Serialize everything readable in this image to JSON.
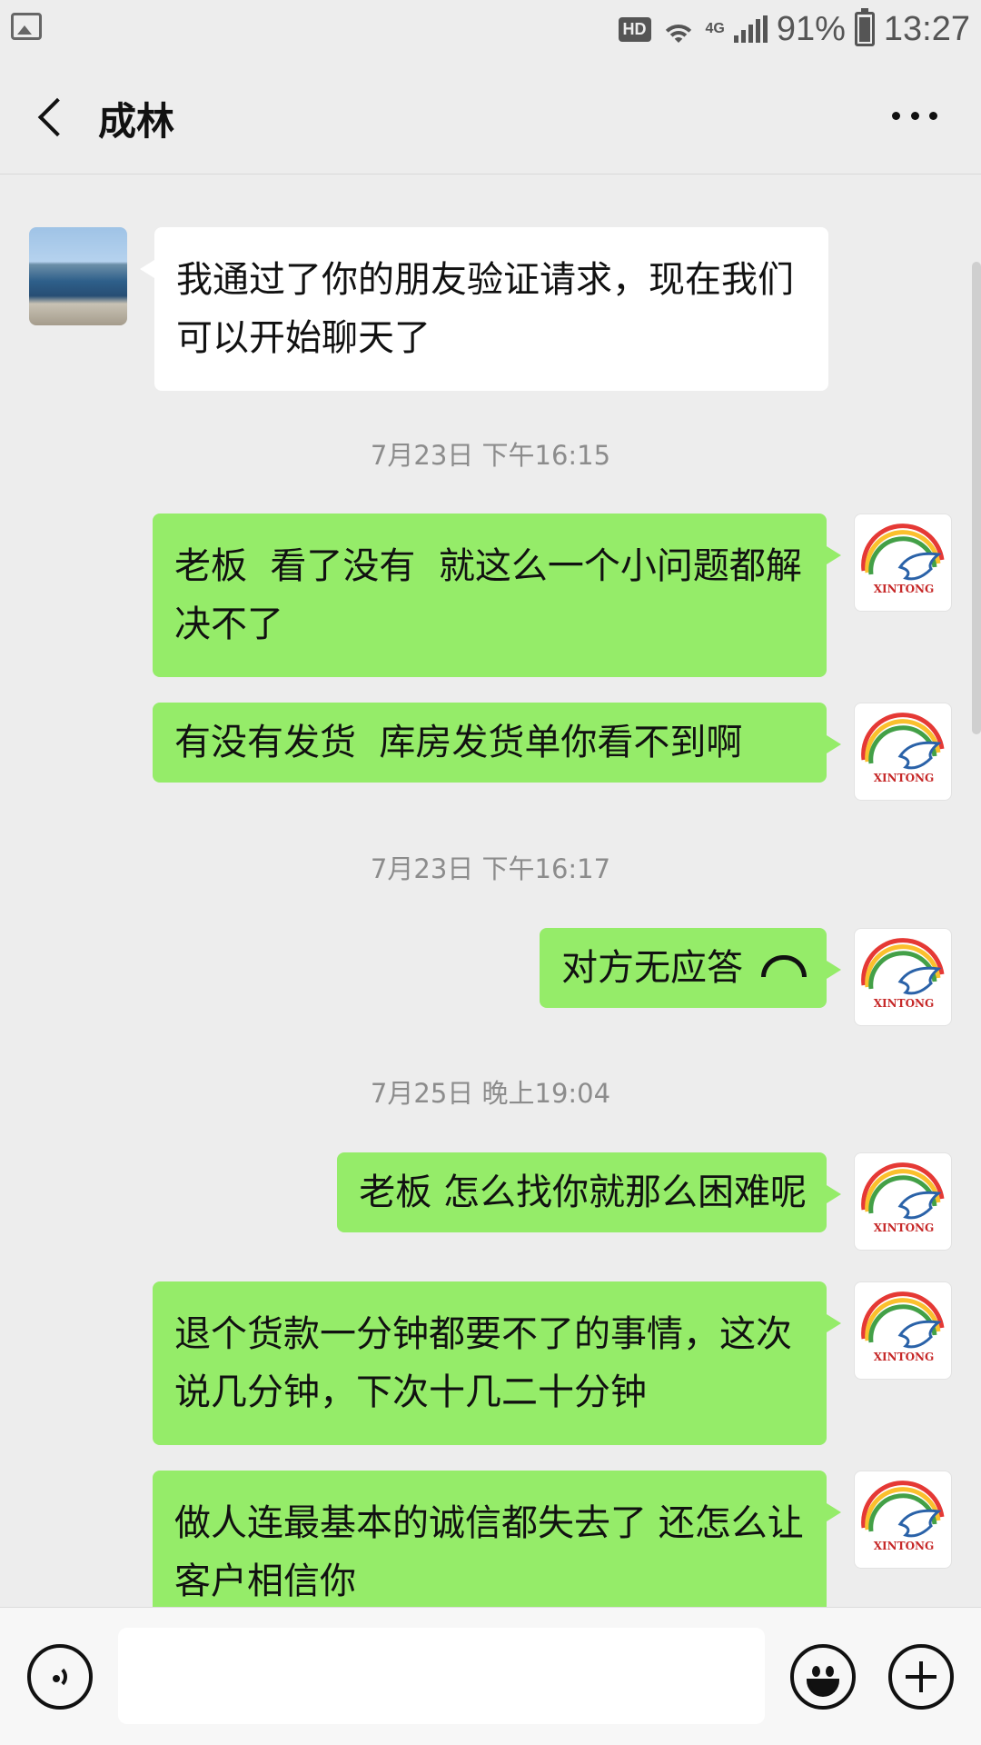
{
  "status_bar": {
    "hd_badge": "HD",
    "network_type": "4G",
    "battery_percent": "91%",
    "time": "13:27"
  },
  "header": {
    "title": "成林",
    "back_icon": "chevron-left-icon",
    "more_icon": "more-dots-icon"
  },
  "chat": {
    "messages": [
      {
        "side": "left",
        "avatar": "lake-photo",
        "text": "我通过了你的朋友验证请求，现在我们可以开始聊天了"
      },
      {
        "timestamp": "7月23日 下午16:15"
      },
      {
        "side": "right",
        "avatar": "xintong-logo",
        "text": "老板  看了没有  就这么一个小问题都解决不了"
      },
      {
        "side": "right",
        "avatar": "xintong-logo",
        "text": "有没有发货  库房发货单你看不到啊"
      },
      {
        "timestamp": "7月23日 下午16:17"
      },
      {
        "side": "right",
        "avatar": "xintong-logo",
        "text": "对方无应答",
        "icon": "hangup-icon"
      },
      {
        "timestamp": "7月25日 晚上19:04"
      },
      {
        "side": "right",
        "avatar": "xintong-logo",
        "text": "老板 怎么找你就那么困难呢"
      },
      {
        "side": "right",
        "avatar": "xintong-logo",
        "text": "退个货款一分钟都要不了的事情，这次说几分钟，下次十几二十分钟"
      },
      {
        "side": "right",
        "avatar": "xintong-logo",
        "text": "做人连最基本的诚信都失去了 还怎么让客户相信你"
      }
    ]
  },
  "logo_text": "XINTONG",
  "input_bar": {
    "input_value": "",
    "voice_icon": "voice-icon",
    "emoji_icon": "emoji-icon",
    "plus_icon": "plus-icon"
  },
  "colors": {
    "background": "#ededed",
    "sent_bubble": "#95ec69",
    "received_bubble": "#ffffff",
    "timestamp_text": "#8c8c8c"
  }
}
